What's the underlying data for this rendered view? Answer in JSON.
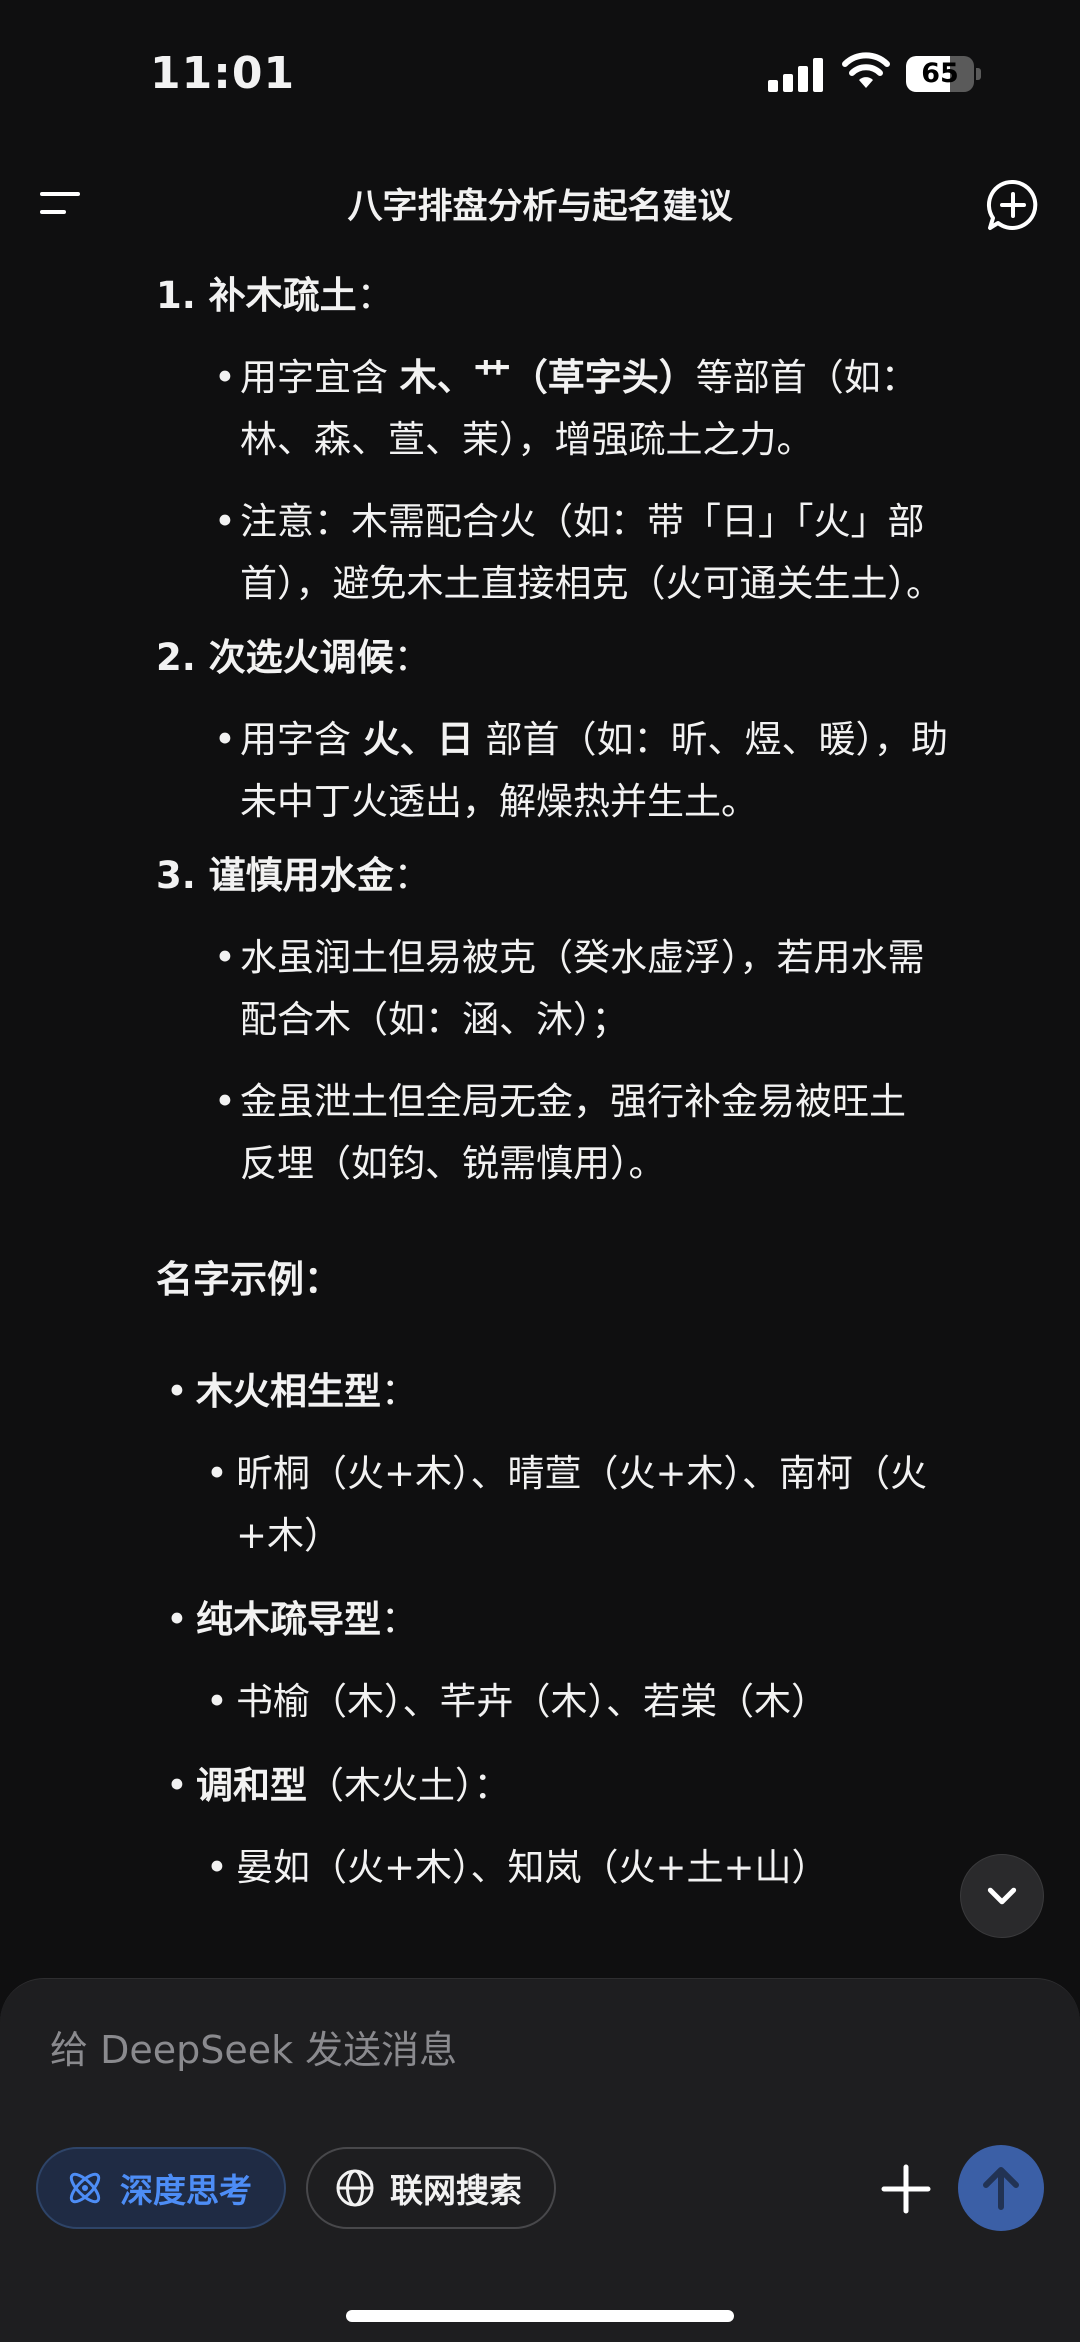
{
  "status_bar": {
    "time": "11:01",
    "battery": "65",
    "battery_level": 0.65
  },
  "header": {
    "title": "八字排盘分析与起名建议"
  },
  "content": {
    "items": [
      {
        "heading": "1. 补木疏土",
        "colon": "：",
        "subs": [
          {
            "lines": [
              [
                {
                  "t": "用字宜含 "
                },
                {
                  "t": "木、艹（草字头）",
                  "b": true
                },
                {
                  "t": "等部首（如："
                }
              ],
              [
                {
                  "t": "林、森、萱、茉），增强疏土之力。"
                }
              ]
            ]
          },
          {
            "lines": [
              [
                {
                  "t": "注意：木需配合火（如：带「日」「火」部"
                }
              ],
              [
                {
                  "t": "首），避免木土直接相克（火可通关生土）。"
                }
              ]
            ]
          }
        ]
      },
      {
        "heading": "2. 次选火调候",
        "colon": "：",
        "subs": [
          {
            "lines": [
              [
                {
                  "t": "用字含 "
                },
                {
                  "t": "火、日",
                  "b": true
                },
                {
                  "t": " 部首（如：昕、煜、暖），助"
                }
              ],
              [
                {
                  "t": "未中丁火透出，解燥热并生土。"
                }
              ]
            ]
          }
        ]
      },
      {
        "heading": "3. 谨慎用水金",
        "colon": "：",
        "subs": [
          {
            "lines": [
              [
                {
                  "t": "水虽润土但易被克（癸水虚浮），若用水需"
                }
              ],
              [
                {
                  "t": "配合木（如：涵、沐）；"
                }
              ]
            ]
          },
          {
            "lines": [
              [
                {
                  "t": "金虽泄土但全局无金，强行补金易被旺土"
                }
              ],
              [
                {
                  "t": "反埋（如钧、锐需慎用）。"
                }
              ]
            ]
          }
        ]
      }
    ],
    "examples_title": "名字示例：",
    "examples": [
      {
        "label": "木火相生型",
        "suffix": "：",
        "lines": [
          "昕桐（火+木）、晴萱（火+木）、南柯（火",
          "+木）"
        ]
      },
      {
        "label": "纯木疏导型",
        "suffix": "：",
        "lines": [
          "书榆（木）、芊卉（木）、若棠（木）"
        ]
      },
      {
        "label": "调和型",
        "suffix": "（木火土）：",
        "lines": [
          "晏如（火+木）、知岚（火+土+山）"
        ]
      }
    ]
  },
  "composer": {
    "placeholder": "给 DeepSeek 发送消息",
    "deep_think_label": "深度思考",
    "web_search_label": "联网搜索"
  },
  "colors": {
    "background": "#0f0f10",
    "accent_blue": "#4d8df6",
    "send_button": "#3b5fa6"
  },
  "icons": [
    "menu-icon",
    "new-chat-icon",
    "chevron-down-icon",
    "atom-icon",
    "globe-icon",
    "plus-icon",
    "arrow-up-icon"
  ]
}
